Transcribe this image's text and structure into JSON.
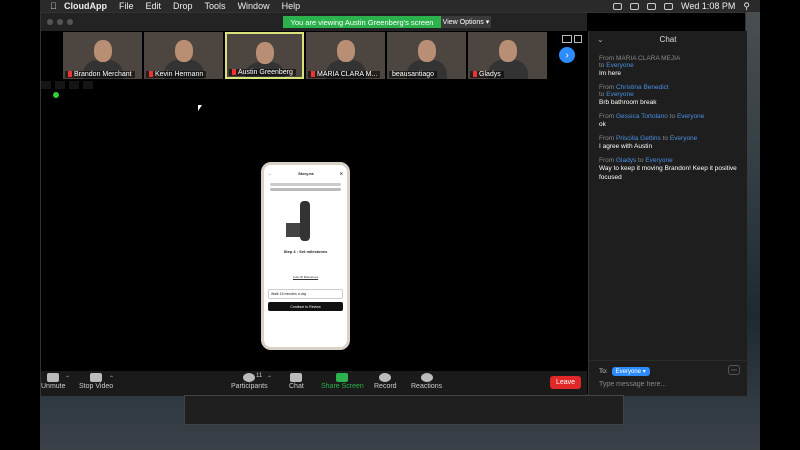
{
  "menubar": {
    "app_name": "CloudApp",
    "items": [
      "File",
      "Edit",
      "Drop",
      "Tools",
      "Window",
      "Help"
    ],
    "clock": "Wed 1:08 PM"
  },
  "share_banner": {
    "text": "You are viewing Austin Greenberg's screen",
    "view_options": "View Options"
  },
  "gallery": {
    "participants": [
      {
        "name": "Brandon Merchant",
        "muted": true
      },
      {
        "name": "Kevin Hermann",
        "muted": true
      },
      {
        "name": "Austin Greenberg",
        "muted": true,
        "active": true
      },
      {
        "name": "MARIA CLARA M...",
        "muted": true
      },
      {
        "name": "beausantiago",
        "muted": false
      },
      {
        "name": "Gladys",
        "muted": true
      }
    ]
  },
  "phone": {
    "header": "Story.ea",
    "step_title": "Step 4 : Set milestones",
    "link": "Auto-fill Milestones",
    "input_value": "Walk 15 minutes a day",
    "cta": "Continue to Review"
  },
  "toolbar": {
    "unmute": "Unmute",
    "stop_video": "Stop Video",
    "participants": "Participants",
    "participants_count": "11",
    "chat": "Chat",
    "share_screen": "Share Screen",
    "record": "Record",
    "reactions": "Reactions",
    "leave": "Leave"
  },
  "chat": {
    "title": "Chat",
    "messages": [
      {
        "from": "MARIA CLARA MEJIA",
        "to": "Everyone",
        "text": "Im here",
        "from_gray": true
      },
      {
        "from": "Christina Benedict",
        "to": "Everyone",
        "text": "Brb bathroom break",
        "from_gray": false
      },
      {
        "from": "Gessica Tortolano",
        "to": "Everyone",
        "text": "ok",
        "from_gray": false
      },
      {
        "from": "Priscilla Gettins",
        "to": "Everyone",
        "text": "I agree with Austin",
        "from_gray": false
      },
      {
        "from": "Gladys",
        "to": "Everyone",
        "text": "Way to keep it moving Brandon! Keep it positive focused",
        "from_gray": false
      }
    ],
    "to_label": "To:",
    "to_value": "Everyone",
    "input_placeholder": "Type message here..."
  }
}
